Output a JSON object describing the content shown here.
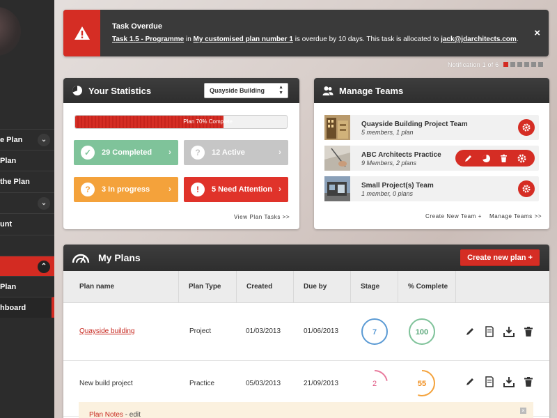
{
  "sidebar": {
    "items": [
      {
        "label": "e Plan"
      },
      {
        "label": "Plan"
      },
      {
        "label": "the Plan"
      },
      {
        "label": ""
      },
      {
        "label": "unt"
      },
      {
        "label": ""
      },
      {
        "label": ""
      },
      {
        "label": "Plan"
      },
      {
        "label": "hboard"
      }
    ]
  },
  "notification": {
    "title": "Task Overdue",
    "task_link": "Task 1.5 - Programme",
    "in_text": " in ",
    "plan_link": "My customised plan number 1",
    "overdue_text": " is overdue by 10 days. This task is allocated to ",
    "email_link": "jack@jdarchitects.com",
    "end_text": ".",
    "close": "×",
    "counter": "Notification 1 of 6",
    "pages": 6,
    "current_page": 1
  },
  "stats": {
    "title": "Your Statistics",
    "select_value": "Quayside Building",
    "progress_label": "Plan 70% Complete",
    "progress_percent": 70,
    "completed": "29 Completed",
    "active": "12 Active",
    "in_progress": "3 In progress",
    "need_attention": "5 Need Attention",
    "view_link": "View Plan Tasks >>"
  },
  "teams": {
    "title": "Manage Teams",
    "rows": [
      {
        "name": "Quayside Building Project Team",
        "meta": "5 members, 1 plan"
      },
      {
        "name": "ABC Architects Practice",
        "meta": "9 Members, 2 plans"
      },
      {
        "name": "Small Project(s) Team",
        "meta": "1 member, 0 plans"
      }
    ],
    "create_link": "Create New Team +",
    "manage_link": "Manage Teams >>"
  },
  "plans": {
    "title": "My Plans",
    "create_button": "Create new plan +",
    "columns": [
      "Plan name",
      "Plan Type",
      "Created",
      "Due by",
      "Stage",
      "% Complete"
    ],
    "rows": [
      {
        "name": "Quayside building",
        "type": "Project",
        "created": "01/03/2013",
        "due": "01/06/2013",
        "stage": "7",
        "stage_fraction": 1.0,
        "complete": "100",
        "complete_fraction": 1.0
      },
      {
        "name": "New build project",
        "type": "Practice",
        "created": "05/03/2013",
        "due": "21/09/2013",
        "stage": "2",
        "stage_fraction": 0.22,
        "complete": "55",
        "complete_fraction": 0.55
      }
    ],
    "notes_label": "Plan Notes",
    "notes_edit": " - edit"
  },
  "colors": {
    "accent": "#d52d24",
    "green": "#7fc39a",
    "orange": "#f4a23b",
    "blue": "#5b9bd5",
    "pink": "#e87a9c"
  }
}
